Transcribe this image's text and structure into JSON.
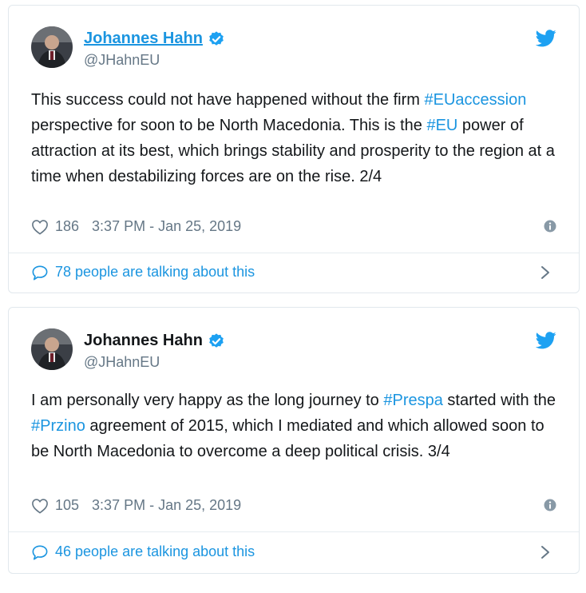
{
  "colors": {
    "link": "#1b95e0",
    "text": "#14171a",
    "muted": "#657786",
    "border": "#e1e8ed"
  },
  "tweets": [
    {
      "display_name": "Johannes Hahn",
      "handle": "@JHahnEU",
      "text_parts": [
        "This success could not have happened without  the firm ",
        "#EUaccession",
        " perspective for soon to be North Macedonia. This is the ",
        "#EU",
        " power of attraction at its best, which brings stability and prosperity to the region at a time when destabilizing forces are on the rise. 2/4"
      ],
      "likes": "186",
      "time": "3:37 PM - Jan 25, 2019",
      "talking": "78 people are talking about this",
      "icons": [
        "verified-badge-icon",
        "twitter-bird-icon",
        "heart-icon",
        "info-icon",
        "speech-bubble-icon",
        "chevron-right-icon"
      ]
    },
    {
      "display_name": "Johannes Hahn",
      "handle": "@JHahnEU",
      "text_parts": [
        "I am personally very happy as the long journey to ",
        "#Prespa",
        " started with the ",
        "#Przino",
        " agreement of 2015, which I mediated and which allowed soon to be North Macedonia to overcome a deep political crisis.  3/4"
      ],
      "likes": "105",
      "time": "3:37 PM - Jan 25, 2019",
      "talking": "46 people are talking about this",
      "icons": [
        "verified-badge-icon",
        "twitter-bird-icon",
        "heart-icon",
        "info-icon",
        "speech-bubble-icon",
        "chevron-right-icon"
      ]
    }
  ]
}
